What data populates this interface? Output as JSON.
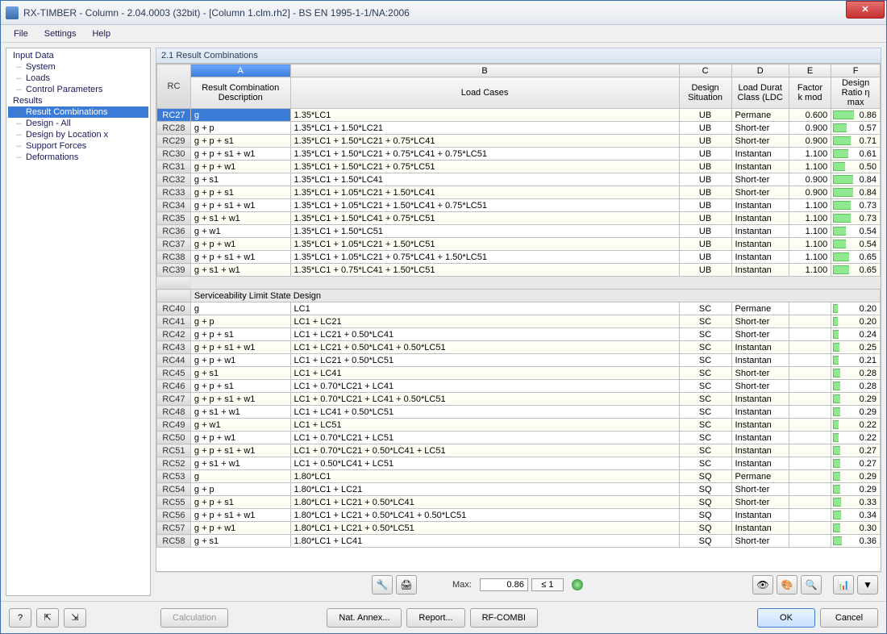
{
  "window": {
    "title": "RX-TIMBER - Column - 2.04.0003 (32bit) - [Column 1.clm.rh2] - BS EN 1995-1-1/NA:2006"
  },
  "menu": {
    "file": "File",
    "settings": "Settings",
    "help": "Help"
  },
  "tree": {
    "input_data": "Input Data",
    "system": "System",
    "loads": "Loads",
    "control_params": "Control Parameters",
    "results": "Results",
    "result_combinations": "Result Combinations",
    "design_all": "Design - All",
    "design_by_loc": "Design by Location x",
    "support_forces": "Support Forces",
    "deformations": "Deformations"
  },
  "panel_title": "2.1 Result Combinations",
  "columns": {
    "rc": "RC",
    "letters": {
      "a": "A",
      "b": "B",
      "c": "C",
      "d": "D",
      "e": "E",
      "f": "F"
    },
    "desc": "Result Combination\nDescription",
    "loadcases": "Load Cases",
    "situation": "Design\nSituation",
    "ldc": "Load Durat\nClass (LDC",
    "kmod": "Factor\nk mod",
    "ratio": "Design\nRatio η max"
  },
  "section2_title": "Serviceability Limit State Design",
  "rows": [
    {
      "rc": "RC27",
      "desc": "g",
      "lc": "1.35*LC1",
      "sit": "UB",
      "ldc": "Permane",
      "k": "0.600",
      "r": 0.86,
      "sel": true
    },
    {
      "rc": "RC28",
      "desc": "g + p",
      "lc": "1.35*LC1 + 1.50*LC21",
      "sit": "UB",
      "ldc": "Short-ter",
      "k": "0.900",
      "r": 0.57
    },
    {
      "rc": "RC29",
      "desc": "g + p + s1",
      "lc": "1.35*LC1 + 1.50*LC21 + 0.75*LC41",
      "sit": "UB",
      "ldc": "Short-ter",
      "k": "0.900",
      "r": 0.71
    },
    {
      "rc": "RC30",
      "desc": "g + p + s1 + w1",
      "lc": "1.35*LC1 + 1.50*LC21 + 0.75*LC41 + 0.75*LC51",
      "sit": "UB",
      "ldc": "Instantan",
      "k": "1.100",
      "r": 0.61
    },
    {
      "rc": "RC31",
      "desc": "g + p + w1",
      "lc": "1.35*LC1 + 1.50*LC21 + 0.75*LC51",
      "sit": "UB",
      "ldc": "Instantan",
      "k": "1.100",
      "r": 0.5
    },
    {
      "rc": "RC32",
      "desc": "g + s1",
      "lc": "1.35*LC1 + 1.50*LC41",
      "sit": "UB",
      "ldc": "Short-ter",
      "k": "0.900",
      "r": 0.84
    },
    {
      "rc": "RC33",
      "desc": "g + p + s1",
      "lc": "1.35*LC1 + 1.05*LC21 + 1.50*LC41",
      "sit": "UB",
      "ldc": "Short-ter",
      "k": "0.900",
      "r": 0.84
    },
    {
      "rc": "RC34",
      "desc": "g + p + s1 + w1",
      "lc": "1.35*LC1 + 1.05*LC21 + 1.50*LC41 + 0.75*LC51",
      "sit": "UB",
      "ldc": "Instantan",
      "k": "1.100",
      "r": 0.73
    },
    {
      "rc": "RC35",
      "desc": "g + s1 + w1",
      "lc": "1.35*LC1 + 1.50*LC41 + 0.75*LC51",
      "sit": "UB",
      "ldc": "Instantan",
      "k": "1.100",
      "r": 0.73
    },
    {
      "rc": "RC36",
      "desc": "g + w1",
      "lc": "1.35*LC1 + 1.50*LC51",
      "sit": "UB",
      "ldc": "Instantan",
      "k": "1.100",
      "r": 0.54
    },
    {
      "rc": "RC37",
      "desc": "g + p + w1",
      "lc": "1.35*LC1 + 1.05*LC21 + 1.50*LC51",
      "sit": "UB",
      "ldc": "Instantan",
      "k": "1.100",
      "r": 0.54
    },
    {
      "rc": "RC38",
      "desc": "g + p + s1 + w1",
      "lc": "1.35*LC1 + 1.05*LC21 + 0.75*LC41 + 1.50*LC51",
      "sit": "UB",
      "ldc": "Instantan",
      "k": "1.100",
      "r": 0.65
    },
    {
      "rc": "RC39",
      "desc": "g + s1 + w1",
      "lc": "1.35*LC1 + 0.75*LC41 + 1.50*LC51",
      "sit": "UB",
      "ldc": "Instantan",
      "k": "1.100",
      "r": 0.65
    }
  ],
  "rows2": [
    {
      "rc": "RC40",
      "desc": "g",
      "lc": "LC1",
      "sit": "SC",
      "ldc": "Permane",
      "k": "",
      "r": 0.2
    },
    {
      "rc": "RC41",
      "desc": "g + p",
      "lc": "LC1 + LC21",
      "sit": "SC",
      "ldc": "Short-ter",
      "k": "",
      "r": 0.2
    },
    {
      "rc": "RC42",
      "desc": "g + p + s1",
      "lc": "LC1 + LC21 + 0.50*LC41",
      "sit": "SC",
      "ldc": "Short-ter",
      "k": "",
      "r": 0.24
    },
    {
      "rc": "RC43",
      "desc": "g + p + s1 + w1",
      "lc": "LC1 + LC21 + 0.50*LC41 + 0.50*LC51",
      "sit": "SC",
      "ldc": "Instantan",
      "k": "",
      "r": 0.25
    },
    {
      "rc": "RC44",
      "desc": "g + p + w1",
      "lc": "LC1 + LC21 + 0.50*LC51",
      "sit": "SC",
      "ldc": "Instantan",
      "k": "",
      "r": 0.21
    },
    {
      "rc": "RC45",
      "desc": "g + s1",
      "lc": "LC1 + LC41",
      "sit": "SC",
      "ldc": "Short-ter",
      "k": "",
      "r": 0.28
    },
    {
      "rc": "RC46",
      "desc": "g + p + s1",
      "lc": "LC1 + 0.70*LC21 + LC41",
      "sit": "SC",
      "ldc": "Short-ter",
      "k": "",
      "r": 0.28
    },
    {
      "rc": "RC47",
      "desc": "g + p + s1 + w1",
      "lc": "LC1 + 0.70*LC21 + LC41 + 0.50*LC51",
      "sit": "SC",
      "ldc": "Instantan",
      "k": "",
      "r": 0.29
    },
    {
      "rc": "RC48",
      "desc": "g + s1 + w1",
      "lc": "LC1 + LC41 + 0.50*LC51",
      "sit": "SC",
      "ldc": "Instantan",
      "k": "",
      "r": 0.29
    },
    {
      "rc": "RC49",
      "desc": "g + w1",
      "lc": "LC1 + LC51",
      "sit": "SC",
      "ldc": "Instantan",
      "k": "",
      "r": 0.22
    },
    {
      "rc": "RC50",
      "desc": "g + p + w1",
      "lc": "LC1 + 0.70*LC21 + LC51",
      "sit": "SC",
      "ldc": "Instantan",
      "k": "",
      "r": 0.22
    },
    {
      "rc": "RC51",
      "desc": "g + p + s1 + w1",
      "lc": "LC1 + 0.70*LC21 + 0.50*LC41 + LC51",
      "sit": "SC",
      "ldc": "Instantan",
      "k": "",
      "r": 0.27
    },
    {
      "rc": "RC52",
      "desc": "g + s1 + w1",
      "lc": "LC1 + 0.50*LC41 + LC51",
      "sit": "SC",
      "ldc": "Instantan",
      "k": "",
      "r": 0.27
    },
    {
      "rc": "RC53",
      "desc": "g",
      "lc": "1.80*LC1",
      "sit": "SQ",
      "ldc": "Permane",
      "k": "",
      "r": 0.29
    },
    {
      "rc": "RC54",
      "desc": "g + p",
      "lc": "1.80*LC1 + LC21",
      "sit": "SQ",
      "ldc": "Short-ter",
      "k": "",
      "r": 0.29
    },
    {
      "rc": "RC55",
      "desc": "g + p + s1",
      "lc": "1.80*LC1 + LC21 + 0.50*LC41",
      "sit": "SQ",
      "ldc": "Short-ter",
      "k": "",
      "r": 0.33
    },
    {
      "rc": "RC56",
      "desc": "g + p + s1 + w1",
      "lc": "1.80*LC1 + LC21 + 0.50*LC41 + 0.50*LC51",
      "sit": "SQ",
      "ldc": "Instantan",
      "k": "",
      "r": 0.34
    },
    {
      "rc": "RC57",
      "desc": "g + p + w1",
      "lc": "1.80*LC1 + LC21 + 0.50*LC51",
      "sit": "SQ",
      "ldc": "Instantan",
      "k": "",
      "r": 0.3
    },
    {
      "rc": "RC58",
      "desc": "g + s1",
      "lc": "1.80*LC1 + LC41",
      "sit": "SQ",
      "ldc": "Short-ter",
      "k": "",
      "r": 0.36
    }
  ],
  "toolbar": {
    "max_label": "Max:",
    "max_value": "0.86",
    "limit": "≤ 1"
  },
  "footer": {
    "calculation": "Calculation",
    "nat_annex": "Nat. Annex...",
    "report": "Report...",
    "rf_combi": "RF-COMBI",
    "ok": "OK",
    "cancel": "Cancel"
  }
}
